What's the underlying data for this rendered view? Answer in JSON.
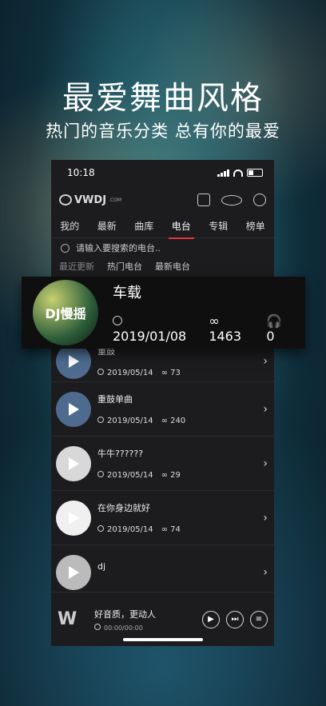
{
  "promo": {
    "headline": "最爱舞曲风格",
    "subline": "热门的音乐分类 总有你的最爱"
  },
  "status_bar": {
    "time": "10:18"
  },
  "app": {
    "logo_text": "VWDJ",
    "logo_sub": ".COM"
  },
  "tabs": [
    "我的",
    "最新",
    "曲库",
    "电台",
    "专辑",
    "榜单"
  ],
  "search": {
    "placeholder": "请输入要搜索的电台.."
  },
  "subtabs": [
    "最近更新",
    "热门电台",
    "最新电台"
  ],
  "featured": {
    "title": "车载",
    "date": "2019/01/08",
    "plays": "1463",
    "listeners": "0",
    "art_text": "DJ慢摇"
  },
  "rows": [
    {
      "title": "重鼓",
      "date": "2019/05/14",
      "plays": "73"
    },
    {
      "title": "重鼓单曲",
      "date": "2019/05/14",
      "plays": "240"
    },
    {
      "title": "牛牛??????",
      "date": "2019/05/14",
      "plays": "29"
    },
    {
      "title": "在你身边就好",
      "date": "2019/05/14",
      "plays": "74"
    },
    {
      "title": "dj",
      "date": "",
      "plays": ""
    }
  ],
  "player": {
    "title": "好音质，更动人",
    "time": "00:00/00:00"
  },
  "colors": {
    "accent": "#e0383e"
  }
}
